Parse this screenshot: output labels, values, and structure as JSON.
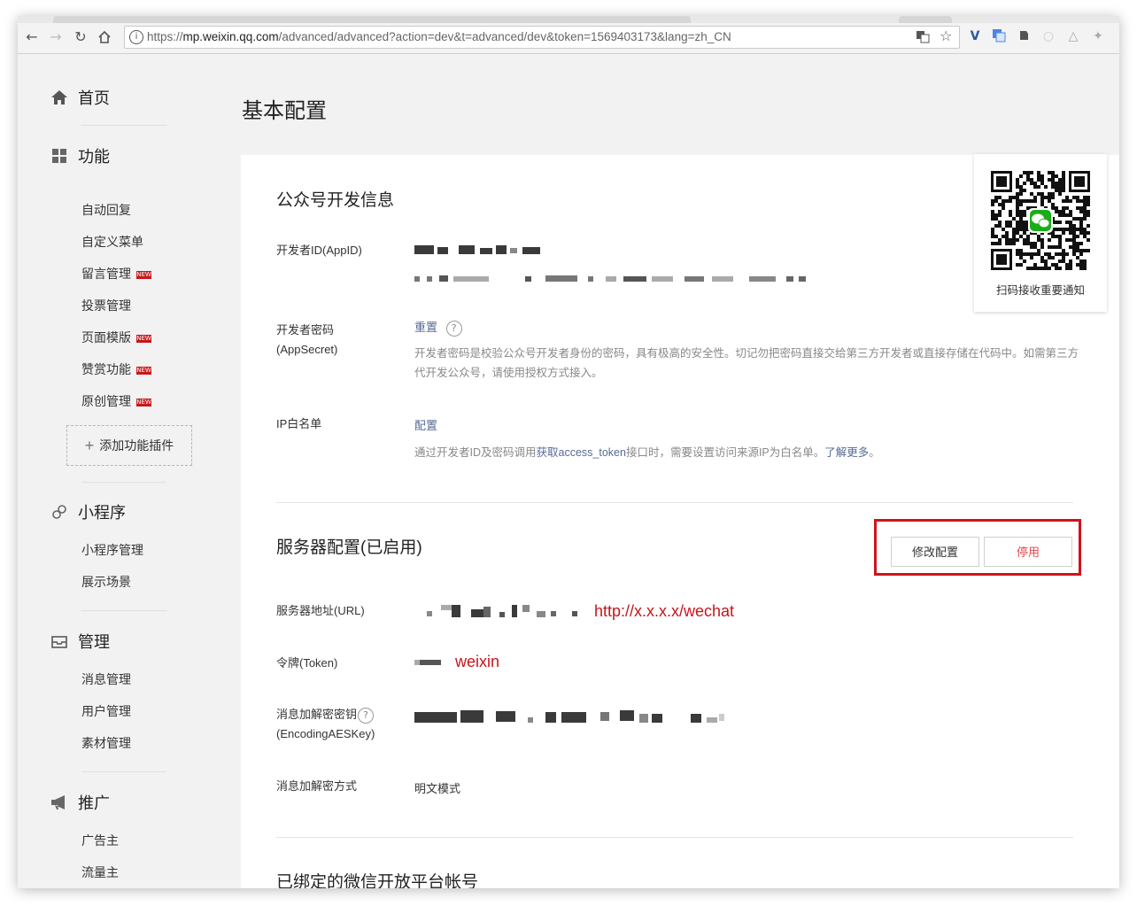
{
  "browser": {
    "url_prefix": "https://",
    "url_domain": "mp.weixin.qq.com",
    "url_path": "/advanced/advanced?action=dev&t=advanced/dev&token=1569403173&lang=zh_CN",
    "nav_icons": [
      "back-icon",
      "forward-icon",
      "reload-icon",
      "home-icon"
    ],
    "extension_icons": [
      "translate-icon",
      "star-icon",
      "vue-icon",
      "google-translate-icon",
      "evernote-icon",
      "extension-icon",
      "extension-icon",
      "extension-icon"
    ]
  },
  "sidebar": {
    "home": {
      "label": "首页",
      "icon": "home-icon"
    },
    "features": {
      "label": "功能",
      "icon": "grid-icon",
      "items": [
        {
          "label": "自动回复",
          "new": false
        },
        {
          "label": "自定义菜单",
          "new": false
        },
        {
          "label": "留言管理",
          "new": true
        },
        {
          "label": "投票管理",
          "new": false
        },
        {
          "label": "页面模版",
          "new": true
        },
        {
          "label": "赞赏功能",
          "new": true
        },
        {
          "label": "原创管理",
          "new": true
        }
      ],
      "new_badge": "NEW",
      "add_plugin": "添加功能插件"
    },
    "mini_program": {
      "label": "小程序",
      "icon": "mini-program-icon",
      "items": [
        "小程序管理",
        "展示场景"
      ]
    },
    "management": {
      "label": "管理",
      "icon": "inbox-icon",
      "items": [
        "消息管理",
        "用户管理",
        "素材管理"
      ]
    },
    "promotion": {
      "label": "推广",
      "icon": "megaphone-icon",
      "items": [
        "广告主",
        "流量主"
      ]
    }
  },
  "page_title": "基本配置",
  "dev_info": {
    "title": "公众号开发信息",
    "appid_label": "开发者ID(AppID)",
    "secret_label_line1": "开发者密码",
    "secret_label_line2": "(AppSecret)",
    "secret_reset": "重置",
    "secret_desc": "开发者密码是校验公众号开发者身份的密码，具有极高的安全性。切记勿把密码直接交给第三方开发者或直接存储在代码中。如需第三方代开发公众号，请使用授权方式接入。",
    "ip_label": "IP白名单",
    "ip_config": "配置",
    "ip_desc_1": "通过开发者ID及密码调用",
    "ip_desc_link": "获取access_token",
    "ip_desc_2": "接口时，需要设置访问来源IP为白名单。",
    "ip_desc_more": "了解更多"
  },
  "server_config": {
    "title": "服务器配置(已启用)",
    "modify_button": "修改配置",
    "disable_button": "停用",
    "url_label": "服务器地址(URL)",
    "url_annotation": "http://x.x.x.x/wechat",
    "token_label": "令牌(Token)",
    "token_annotation": "weixin",
    "aeskey_label_line1": "消息加解密密钥",
    "aeskey_label_line2": "(EncodingAESKey)",
    "mode_label": "消息加解密方式",
    "mode_value": "明文模式"
  },
  "bound_platform": {
    "title": "已绑定的微信开放平台帐号"
  },
  "qr": {
    "caption": "扫码接收重要通知"
  },
  "colors": {
    "link": "#576b95",
    "annotation_red": "#c6151b",
    "new_badge": "#c7161c",
    "disable_text": "#e24b4b",
    "wechat_green": "#1aad19"
  }
}
